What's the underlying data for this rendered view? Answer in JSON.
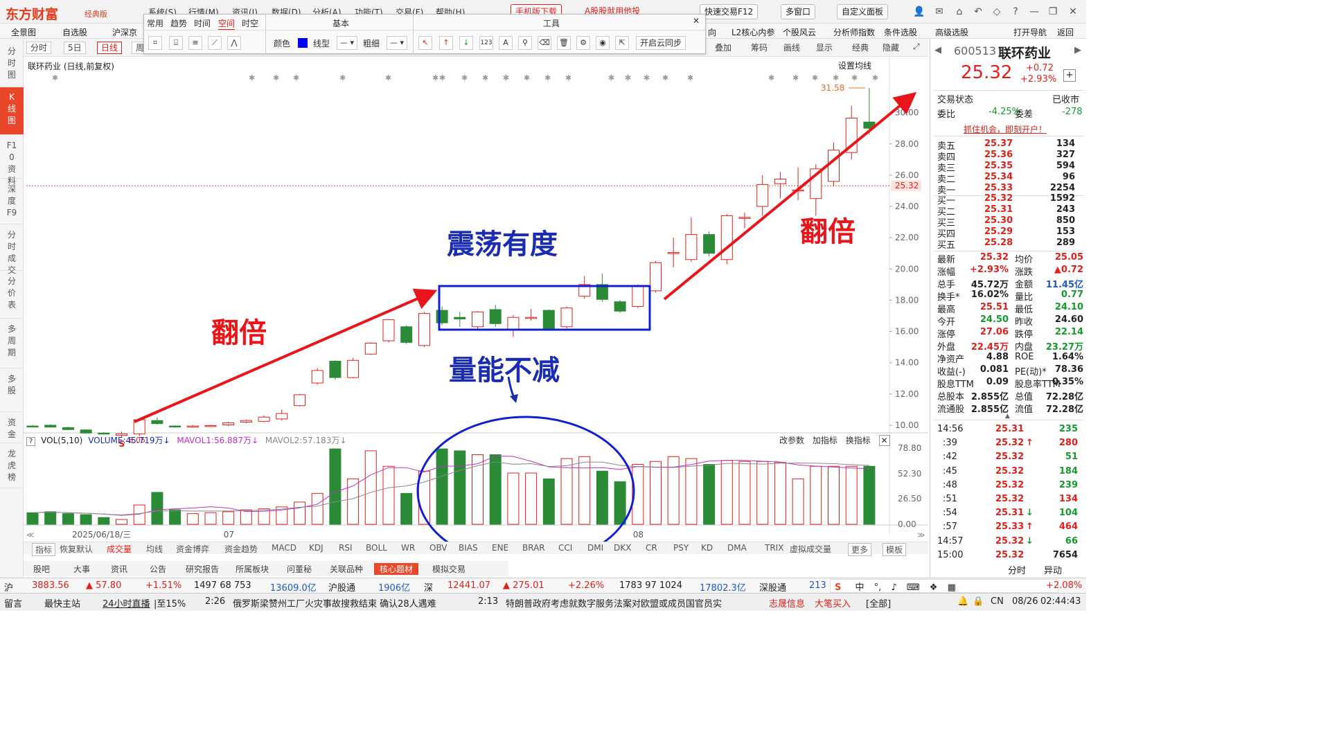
{
  "titlebar": {
    "logo": "东方财富",
    "edition": "经典版",
    "menus": [
      "系统(S)",
      "行情(M)",
      "资讯(I)",
      "数据(D)",
      "分析(A)",
      "功能(T)",
      "交易(F)",
      "帮助(H)"
    ],
    "promo1": "手机版下载",
    "promo2": "A股股就用他投",
    "quick_trade": "快速交易F12",
    "multi_window": "多窗口",
    "custom_panel": "自定义面板"
  },
  "nav2": {
    "items_left": [
      "全景图",
      "自选股",
      "沪深京"
    ],
    "items_right": [
      "向",
      "L2核心内参",
      "个股风云",
      "分析师指数",
      "条件选股",
      "高级选股",
      "打开导航",
      "返回"
    ]
  },
  "sidebar": [
    {
      "label": "分时图",
      "active": false
    },
    {
      "label": "K线图",
      "active": true
    },
    {
      "label": "F10资料",
      "active": false
    },
    {
      "label": "深度F9",
      "active": false
    },
    {
      "label": "分时成交",
      "active": false
    },
    {
      "label": "分价表",
      "active": false
    },
    {
      "label": "多周期",
      "active": false
    },
    {
      "label": "多股",
      "active": false
    },
    {
      "label": "资金",
      "active": false
    },
    {
      "label": "龙虎榜",
      "active": false
    }
  ],
  "chart_toolbar": {
    "periods": [
      "分时",
      "5日",
      "日线",
      "周"
    ],
    "right_items": [
      "叠加",
      "筹码",
      "画线",
      "显示",
      "经典",
      "隐藏"
    ]
  },
  "drawbar": {
    "tabs": [
      "常用",
      "趋势",
      "时间",
      "空间",
      "时空"
    ],
    "active_tab": "空间",
    "section_basic": "基本",
    "section_tools": "工具",
    "color_label": "颜色",
    "color_value": "#0000ff",
    "linetype_label": "线型",
    "thickness_label": "粗细",
    "cloud_sync": "开启云同步",
    "close": "✕"
  },
  "chart": {
    "stock_label": "联环药业 (日线,前复权)",
    "set_ma": "设置均线",
    "last_price_label": "25.32",
    "high_label": "31.58",
    "low_label": "8.05",
    "date_label": "2025/06/18/三",
    "month_labels": [
      "07",
      "08"
    ],
    "price_ticks": [
      "30.00",
      "28.00",
      "26.00",
      "24.00",
      "22.00",
      "20.00",
      "18.00",
      "16.00",
      "14.00",
      "12.00",
      "10.00"
    ],
    "vol_ticks": [
      "78.80",
      "52.30",
      "26.50",
      "0.00"
    ],
    "annotations": {
      "double1": "翻倍",
      "range": "震荡有度",
      "volume": "量能不减",
      "double2": "翻倍"
    },
    "colors": {
      "up": "#e0201a",
      "down": "#2a8a36",
      "annot_red": "#e8161b",
      "annot_blue": "#1a2db0"
    }
  },
  "chart_data": {
    "type": "candlestick",
    "price_ylim": [
      9.2,
      31.8
    ],
    "volume_ylim": [
      0,
      78.8
    ],
    "candles": [
      {
        "o": 9.95,
        "c": 9.9,
        "h": 10.02,
        "l": 9.86,
        "v": 12
      },
      {
        "o": 10.0,
        "c": 9.88,
        "h": 10.05,
        "l": 9.85,
        "v": 13
      },
      {
        "o": 9.85,
        "c": 9.72,
        "h": 9.9,
        "l": 9.68,
        "v": 11
      },
      {
        "o": 9.7,
        "c": 9.5,
        "h": 9.72,
        "l": 9.45,
        "v": 10
      },
      {
        "o": 9.5,
        "c": 9.45,
        "h": 9.55,
        "l": 9.4,
        "v": 7
      },
      {
        "o": 9.35,
        "c": 9.45,
        "h": 9.58,
        "l": 9.25,
        "v": 5
      },
      {
        "o": 9.45,
        "c": 10.35,
        "h": 10.4,
        "l": 9.3,
        "v": 20
      },
      {
        "o": 10.3,
        "c": 10.1,
        "h": 10.5,
        "l": 10.05,
        "v": 33
      },
      {
        "o": 9.95,
        "c": 9.9,
        "h": 10.0,
        "l": 9.85,
        "v": 15
      },
      {
        "o": 9.88,
        "c": 9.95,
        "h": 10.02,
        "l": 9.84,
        "v": 11
      },
      {
        "o": 9.92,
        "c": 9.98,
        "h": 10.02,
        "l": 9.88,
        "v": 12
      },
      {
        "o": 10.02,
        "c": 10.15,
        "h": 10.22,
        "l": 9.95,
        "v": 13
      },
      {
        "o": 10.2,
        "c": 10.3,
        "h": 10.36,
        "l": 10.12,
        "v": 15
      },
      {
        "o": 10.25,
        "c": 10.52,
        "h": 10.62,
        "l": 10.2,
        "v": 16
      },
      {
        "o": 10.4,
        "c": 10.75,
        "h": 11.0,
        "l": 10.3,
        "v": 18
      },
      {
        "o": 11.25,
        "c": 11.95,
        "h": 12.0,
        "l": 11.2,
        "v": 23
      },
      {
        "o": 12.7,
        "c": 13.5,
        "h": 13.65,
        "l": 12.6,
        "v": 32
      },
      {
        "o": 14.1,
        "c": 13.05,
        "h": 14.15,
        "l": 12.9,
        "v": 78
      },
      {
        "o": 13.05,
        "c": 14.15,
        "h": 14.3,
        "l": 13.0,
        "v": 47
      },
      {
        "o": 14.55,
        "c": 15.25,
        "h": 15.3,
        "l": 14.5,
        "v": 76
      },
      {
        "o": 15.4,
        "c": 16.75,
        "h": 16.8,
        "l": 15.3,
        "v": 60
      },
      {
        "o": 16.3,
        "c": 15.3,
        "h": 16.4,
        "l": 15.2,
        "v": 32
      },
      {
        "o": 15.1,
        "c": 17.15,
        "h": 17.25,
        "l": 15.0,
        "v": 55
      },
      {
        "o": 17.35,
        "c": 16.55,
        "h": 17.6,
        "l": 16.4,
        "v": 78
      },
      {
        "o": 16.9,
        "c": 16.8,
        "h": 17.25,
        "l": 16.3,
        "v": 76
      },
      {
        "o": 16.3,
        "c": 17.25,
        "h": 17.3,
        "l": 16.1,
        "v": 72
      },
      {
        "o": 17.4,
        "c": 16.5,
        "h": 17.7,
        "l": 16.3,
        "v": 72
      },
      {
        "o": 16.1,
        "c": 16.9,
        "h": 17.05,
        "l": 15.65,
        "v": 53
      },
      {
        "o": 16.9,
        "c": 16.9,
        "h": 17.45,
        "l": 16.7,
        "v": 53
      },
      {
        "o": 17.35,
        "c": 16.2,
        "h": 17.4,
        "l": 16.1,
        "v": 47
      },
      {
        "o": 16.3,
        "c": 17.5,
        "h": 17.6,
        "l": 16.2,
        "v": 68
      },
      {
        "o": 18.25,
        "c": 19.0,
        "h": 19.55,
        "l": 18.1,
        "v": 70
      },
      {
        "o": 19.0,
        "c": 18.05,
        "h": 19.7,
        "l": 17.9,
        "v": 55
      },
      {
        "o": 17.9,
        "c": 17.3,
        "h": 18.0,
        "l": 17.2,
        "v": 44
      },
      {
        "o": 17.6,
        "c": 18.9,
        "h": 19.0,
        "l": 17.5,
        "v": 62
      },
      {
        "o": 18.6,
        "c": 20.4,
        "h": 20.5,
        "l": 18.5,
        "v": 65
      },
      {
        "o": 21.05,
        "c": 21.05,
        "h": 22.0,
        "l": 20.1,
        "v": 70
      },
      {
        "o": 20.6,
        "c": 22.2,
        "h": 23.3,
        "l": 20.45,
        "v": 68
      },
      {
        "o": 22.2,
        "c": 21.0,
        "h": 22.4,
        "l": 20.8,
        "v": 62
      },
      {
        "o": 20.6,
        "c": 23.4,
        "h": 23.5,
        "l": 20.3,
        "v": 66
      },
      {
        "o": 23.3,
        "c": 23.3,
        "h": 23.6,
        "l": 22.6,
        "v": 65
      },
      {
        "o": 24.0,
        "c": 25.4,
        "h": 26.0,
        "l": 23.4,
        "v": 65
      },
      {
        "o": 25.45,
        "c": 25.75,
        "h": 26.2,
        "l": 24.5,
        "v": 64
      },
      {
        "o": 25.05,
        "c": 25.05,
        "h": 26.5,
        "l": 24.4,
        "v": 47
      },
      {
        "o": 24.5,
        "c": 26.4,
        "h": 26.7,
        "l": 23.4,
        "v": 60
      },
      {
        "o": 25.6,
        "c": 27.6,
        "h": 28.1,
        "l": 25.3,
        "v": 60
      },
      {
        "o": 27.45,
        "c": 29.65,
        "h": 30.45,
        "l": 27.0,
        "v": 60
      },
      {
        "o": 29.4,
        "c": 29.0,
        "h": 31.58,
        "l": 28.6,
        "v": 60
      }
    ]
  },
  "volume_header": {
    "name": "VOL(5,10)",
    "volume": "VOLUME:45.719万",
    "ma1": "MAVOL1:56.887万",
    "ma2": "MAVOL2:57.183万",
    "right": [
      "改参数",
      "加指标",
      "换指标"
    ]
  },
  "indicator_tabs": [
    "指标",
    "恢复默认",
    "成交量",
    "均线",
    "资金博弈",
    "资金趋势",
    "MACD",
    "KDJ",
    "RSI",
    "BOLL",
    "WR",
    "OBV",
    "BIAS",
    "ENE",
    "BRAR",
    "CCI",
    "DMI",
    "DKX",
    "CR",
    "PSY",
    "KD",
    "DMA",
    "TRIX",
    "虚拟成交量",
    "更多",
    "模板"
  ],
  "bottom_tabs": [
    "股吧",
    "大事",
    "资讯",
    "公告",
    "研究报告",
    "所属板块",
    "问董秘",
    "关联品种",
    "核心题材",
    "模拟交易"
  ],
  "bottom_active": "核心题材",
  "quote": {
    "code": "600513",
    "name": "联环药业",
    "price": "25.32",
    "change": "+0.72",
    "change_pct": "+2.93%",
    "trade_state_label": "交易状态",
    "trade_state": "已收市",
    "wb_label": "委比",
    "wb": "-4.25%",
    "wc_label": "委差",
    "wc": "-278",
    "promo": "抓住机会，即刻开户！",
    "sells": [
      {
        "label": "卖五",
        "price": "25.37",
        "vol": "134"
      },
      {
        "label": "卖四",
        "price": "25.36",
        "vol": "327"
      },
      {
        "label": "卖三",
        "price": "25.35",
        "vol": "594"
      },
      {
        "label": "卖二",
        "price": "25.34",
        "vol": "96"
      },
      {
        "label": "卖一",
        "price": "25.33",
        "vol": "2254"
      }
    ],
    "buys": [
      {
        "label": "买一",
        "price": "25.32",
        "vol": "1592"
      },
      {
        "label": "买二",
        "price": "25.31",
        "vol": "243"
      },
      {
        "label": "买三",
        "price": "25.30",
        "vol": "850"
      },
      {
        "label": "买四",
        "price": "25.29",
        "vol": "153"
      },
      {
        "label": "买五",
        "price": "25.28",
        "vol": "289"
      }
    ],
    "stats": [
      [
        "最新",
        "25.32",
        "red",
        "均价",
        "25.05",
        "red"
      ],
      [
        "涨幅",
        "+2.93%",
        "red",
        "涨跌",
        "▲0.72",
        "red"
      ],
      [
        "总手",
        "45.72万",
        "bk",
        "金额",
        "11.45亿",
        "blue"
      ],
      [
        "换手*",
        "16.02%",
        "bk",
        "量比",
        "0.77",
        "green"
      ],
      [
        "最高",
        "25.51",
        "red",
        "最低",
        "24.10",
        "green"
      ],
      [
        "今开",
        "24.50",
        "green",
        "昨收",
        "24.60",
        "bk"
      ],
      [
        "涨停",
        "27.06",
        "red",
        "跌停",
        "22.14",
        "green"
      ],
      [
        "外盘",
        "22.45万",
        "red",
        "内盘",
        "23.27万",
        "green"
      ],
      [
        "净资产",
        "4.88",
        "bk",
        "ROE",
        "1.64%",
        "bk"
      ],
      [
        "收益(-)",
        "0.081",
        "bk",
        "PE(动)*",
        "78.36",
        "bk"
      ],
      [
        "股息TTM",
        "0.09",
        "bk",
        "股息率TTM",
        "0.35%",
        "bk"
      ],
      [
        "总股本",
        "2.855亿",
        "bk",
        "总值",
        "72.28亿",
        "bk"
      ],
      [
        "流通股",
        "2.855亿",
        "bk",
        "流值",
        "72.28亿",
        "bk"
      ]
    ],
    "ticks": [
      {
        "time": "14:56",
        "price": "25.31",
        "arrow": "",
        "vol": "235",
        "vc": "green"
      },
      {
        "time": ":39",
        "price": "25.32",
        "arrow": "↑",
        "vol": "280",
        "vc": "red"
      },
      {
        "time": ":42",
        "price": "25.32",
        "arrow": "",
        "vol": "51",
        "vc": "green"
      },
      {
        "time": ":45",
        "price": "25.32",
        "arrow": "",
        "vol": "184",
        "vc": "green"
      },
      {
        "time": ":48",
        "price": "25.32",
        "arrow": "",
        "vol": "239",
        "vc": "green"
      },
      {
        "time": ":51",
        "price": "25.32",
        "arrow": "",
        "vol": "134",
        "vc": "red"
      },
      {
        "time": ":54",
        "price": "25.31",
        "arrow": "↓",
        "vol": "104",
        "vc": "green"
      },
      {
        "time": ":57",
        "price": "25.33",
        "arrow": "↑",
        "vol": "464",
        "vc": "red"
      },
      {
        "time": "14:57",
        "price": "25.32",
        "arrow": "↓",
        "vol": "66",
        "vc": "green"
      },
      {
        "time": "15:00",
        "price": "25.32",
        "arrow": "",
        "vol": "7654",
        "vc": "bk"
      }
    ],
    "bottom": [
      "分时",
      "异动"
    ]
  },
  "status": {
    "sh_label": "沪",
    "sh_index": "3883.56",
    "sh_change": "▲ 57.80",
    "sh_pct": "+1.51%",
    "sh_counts": "1497 68 753",
    "sh_amount": "13609.0亿",
    "hgt_label": "沪股通",
    "hgt_value": "1906亿",
    "sz_label": "深",
    "sz_index": "12441.07",
    "sz_change": "▲ 275.01",
    "sz_pct": "+2.26%",
    "sz_counts": "1783 97 1024",
    "sz_amount": "17802.3亿",
    "sgt_label": "深股通",
    "sgt_value": "213",
    "right_pct": "+2.08%"
  },
  "ticker": {
    "items": [
      "留言",
      "最快主站",
      "24小时直播",
      "|至15%",
      "2:26",
      "俄罗斯梁赞州工厂火灾事故搜救结束 确认28人遇难",
      "2:13",
      "特朗普政府考虑就数字服务法案对欧盟或成员国官员实",
      "志晟信息",
      "大笔买入",
      "[全部]"
    ],
    "locale": "CN",
    "date": "08/26",
    "clock": "02:44:43"
  }
}
